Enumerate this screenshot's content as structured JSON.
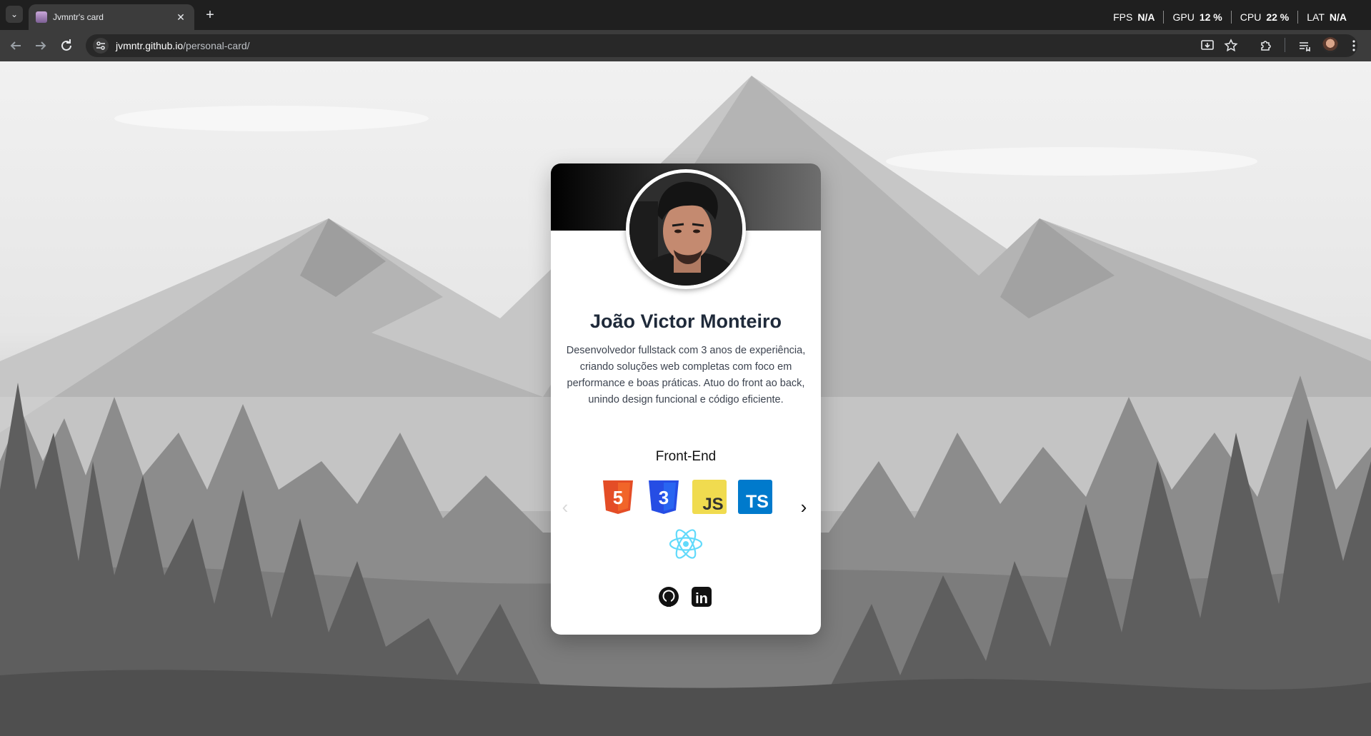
{
  "browser": {
    "tab_title": "Jvmntr's card",
    "tab_close": "✕",
    "new_tab": "+",
    "tab_menu": "⌄",
    "url_host": "jvmntr.github.io",
    "url_path": "/personal-card/",
    "perf": [
      {
        "label": "FPS",
        "value": "N/A"
      },
      {
        "label": "GPU",
        "value": "12 %"
      },
      {
        "label": "CPU",
        "value": "22 %"
      },
      {
        "label": "LAT",
        "value": "N/A"
      }
    ]
  },
  "card": {
    "name": "João Victor Monteiro",
    "bio": "Desenvolvedor fullstack com 3 anos de experiência, criando soluções web completas com foco em performance e boas práticas. Atuo do front ao back, unindo design funcional e código eficiente.",
    "section_title": "Front-End",
    "technologies": [
      {
        "name": "HTML5",
        "icon": "html5-icon",
        "label": "5",
        "color": "#e44d26"
      },
      {
        "name": "CSS3",
        "icon": "css3-icon",
        "label": "3",
        "color": "#264de4"
      },
      {
        "name": "JavaScript",
        "icon": "javascript-icon",
        "label": "JS",
        "color": "#f0db4f"
      },
      {
        "name": "TypeScript",
        "icon": "typescript-icon",
        "label": "TS",
        "color": "#007acc"
      },
      {
        "name": "React",
        "icon": "react-icon",
        "color": "#61dafb"
      }
    ],
    "carousel_prev": "‹",
    "carousel_next": "›",
    "social": [
      {
        "name": "GitHub",
        "icon": "github-icon"
      },
      {
        "name": "LinkedIn",
        "icon": "linkedin-icon",
        "label": "in"
      }
    ]
  }
}
